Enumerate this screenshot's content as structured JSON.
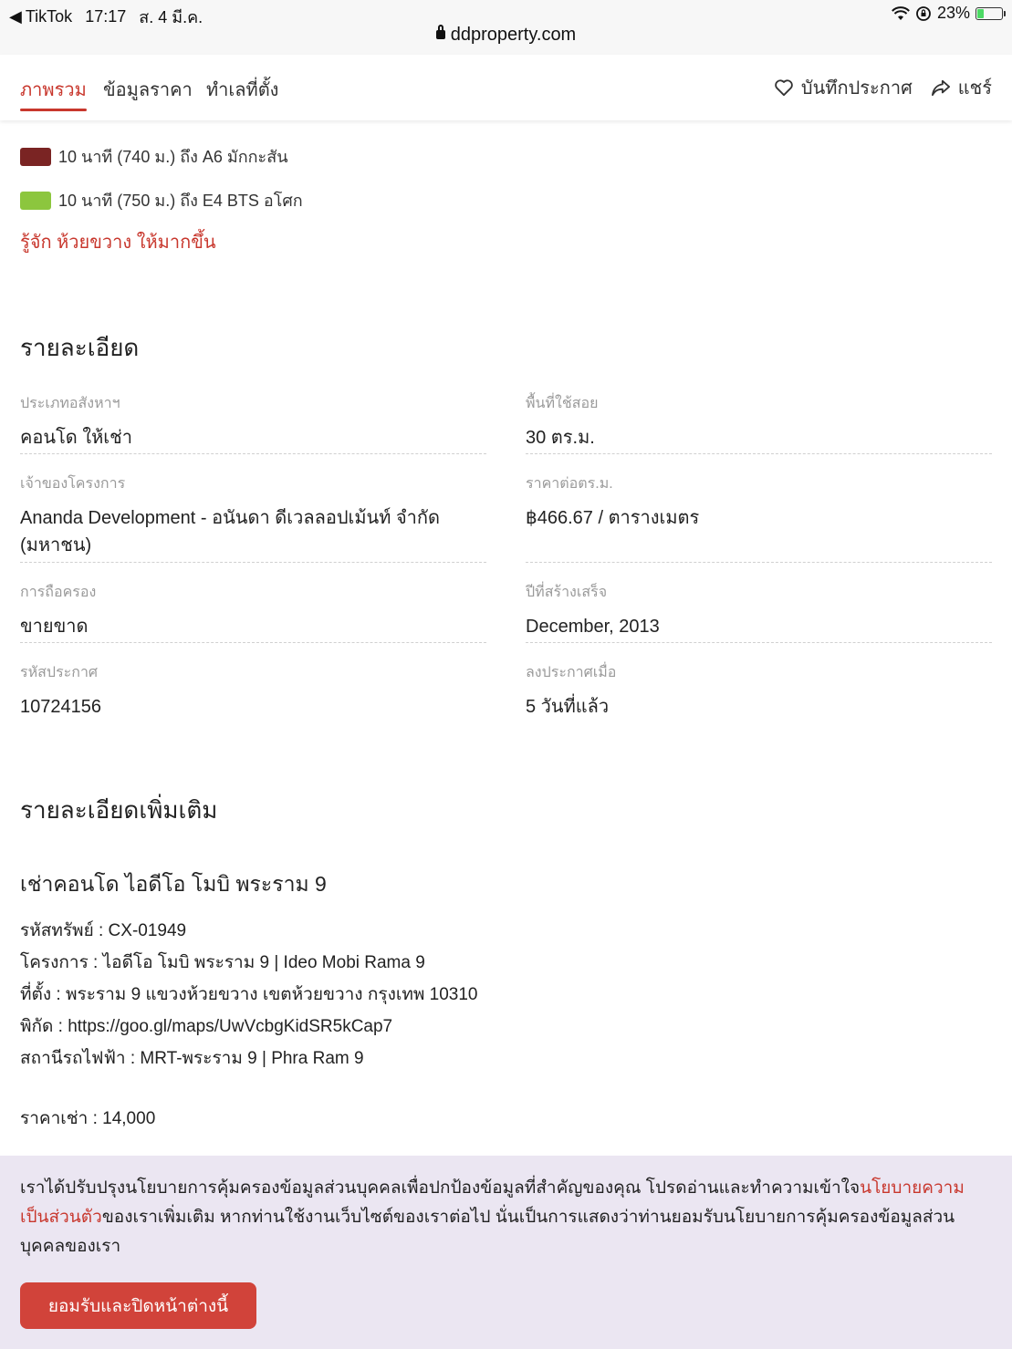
{
  "status_bar": {
    "back_app": "TikTok",
    "time": "17:17",
    "date": "ส. 4 มี.ค.",
    "battery": "23%",
    "url": "ddproperty.com"
  },
  "nav": {
    "tabs": [
      {
        "label": "ภาพรวม",
        "active": true
      },
      {
        "label": "ข้อมูลราคา",
        "active": false
      },
      {
        "label": "ทำเลที่ตั้ง",
        "active": false
      }
    ],
    "save_label": "บันทึกประกาศ",
    "share_label": "แชร์"
  },
  "transit": [
    {
      "text": "10 นาที (740 ม.) ถึง A6 มักกะสัน",
      "color": "#7a2423"
    },
    {
      "text": "10 นาที (750 ม.) ถึง E4 BTS อโศก",
      "color": "#8cc63e"
    }
  ],
  "know_more_link": "รู้จัก ห้วยขวาง ให้มากขึ้น",
  "details": {
    "title": "รายละเอียด",
    "items": [
      {
        "label": "ประเภทอสังหาฯ",
        "value": "คอนโด ให้เช่า"
      },
      {
        "label": "พื้นที่ใช้สอย",
        "value": "30 ตร.ม."
      },
      {
        "label": "เจ้าของโครงการ",
        "value": "Ananda Development - อนันดา ดีเวลลอปเม้นท์ จำกัด (มหาชน)"
      },
      {
        "label": "ราคาต่อตร.ม.",
        "value": "฿466.67 / ตารางเมตร"
      },
      {
        "label": "การถือครอง",
        "value": "ขายขาด"
      },
      {
        "label": "ปีที่สร้างเสร็จ",
        "value": "December, 2013"
      },
      {
        "label": "รหัสประกาศ",
        "value": "10724156"
      },
      {
        "label": "ลงประกาศเมื่อ",
        "value": "5 วันที่แล้ว"
      }
    ]
  },
  "more_details": {
    "title": "รายละเอียดเพิ่มเติม",
    "listing_title": "เช่าคอนโด ไอดีโอ โมบิ พระราม 9",
    "lines": [
      "รหัสทรัพย์ : CX-01949",
      "โครงการ : ไอดีโอ โมบิ พระราม 9 | Ideo Mobi Rama 9",
      "ที่ตั้ง : พระราม 9 แขวงห้วยขวาง เขตห้วยขวาง กรุงเทพ 10310",
      "พิกัด : https://goo.gl/maps/UwVcbgKidSR5kCap7",
      "สถานีรถไฟฟ้า : MRT-พระราม 9 | Phra Ram 9"
    ],
    "price_line": "ราคาเช่า : 14,000"
  },
  "consent": {
    "text_before": "เราได้ปรับปรุงนโยบายการคุ้มครองข้อมูลส่วนบุคคลเพื่อปกป้องข้อมูลที่สำคัญของคุณ โปรดอ่านและทำความเข้าใจ",
    "link": "นโยบายความเป็นส่วนตัว",
    "text_after": "ของเราเพิ่มเติม หากท่านใช้งานเว็บไซต์ของเราต่อไป นั่นเป็นการแสดงว่าท่านยอมรับนโยบายการคุ้มครองข้อมูลส่วนบุคคลของเรา",
    "button": "ยอมรับและปิดหน้าต่างนี้"
  }
}
